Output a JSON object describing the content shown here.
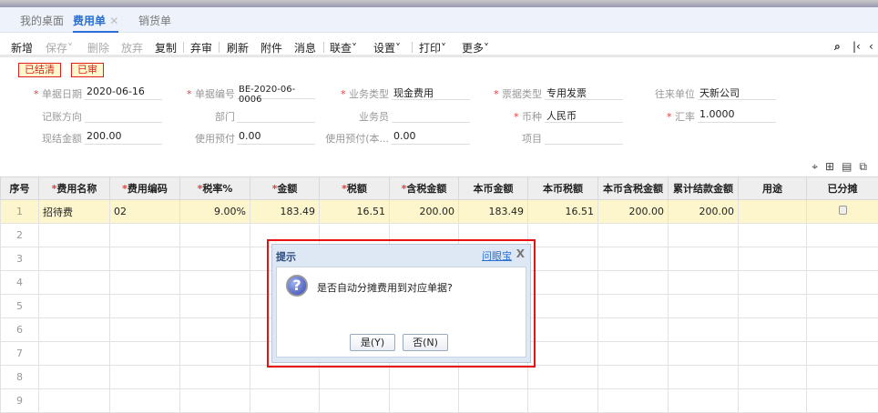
{
  "tabs": [
    {
      "label": "我的桌面"
    },
    {
      "label": "费用单",
      "close": "✕"
    },
    {
      "label": "销货单"
    }
  ],
  "toolbar": [
    "新增",
    "保存˅",
    "删除",
    "放弃",
    "复制",
    "弃审",
    "刷新",
    "附件",
    "消息",
    "联查˅",
    "设置˅",
    "打印˅",
    "更多˅"
  ],
  "badges": [
    "已结清",
    "已审"
  ],
  "form": {
    "date_label": "单据日期",
    "date": "2020-06-16",
    "no_label": "单据编号",
    "no": "BE-2020-06-0006",
    "biztype_label": "业务类型",
    "biztype": "现金费用",
    "invtype_label": "票据类型",
    "invtype": "专用发票",
    "partner_label": "往来单位",
    "partner": "天新公司",
    "direction_label": "记账方向",
    "dept_label": "部门",
    "staff_label": "业务员",
    "currency_label": "币种",
    "currency": "人民币",
    "rate_label": "汇率",
    "rate": "1.0000",
    "cash_label": "现结金额",
    "cash": "200.00",
    "prepay_label": "使用预付",
    "prepay": "0.00",
    "prepay_local_label": "使用预付(本...",
    "prepay_local": "0.00",
    "project_label": "项目"
  },
  "table": {
    "headers": [
      "序号",
      "费用名称",
      "费用编码",
      "税率%",
      "金额",
      "税额",
      "含税金额",
      "本币金额",
      "本币税额",
      "本币含税金额",
      "累计结款金额",
      "用途",
      "已分摊"
    ],
    "rows": [
      [
        "1",
        "招待费",
        "02",
        "9.00%",
        "183.49",
        "16.51",
        "200.00",
        "183.49",
        "16.51",
        "200.00",
        "200.00",
        ""
      ]
    ],
    "empty_rows": [
      "2",
      "3",
      "4",
      "5",
      "6",
      "7",
      "8",
      "9"
    ]
  },
  "dialog": {
    "title": "提示",
    "help": "问眼宝",
    "close": "X",
    "message": "是否自动分摊费用到对应单据?",
    "yes": "是(Y)",
    "no": "否(N)"
  }
}
